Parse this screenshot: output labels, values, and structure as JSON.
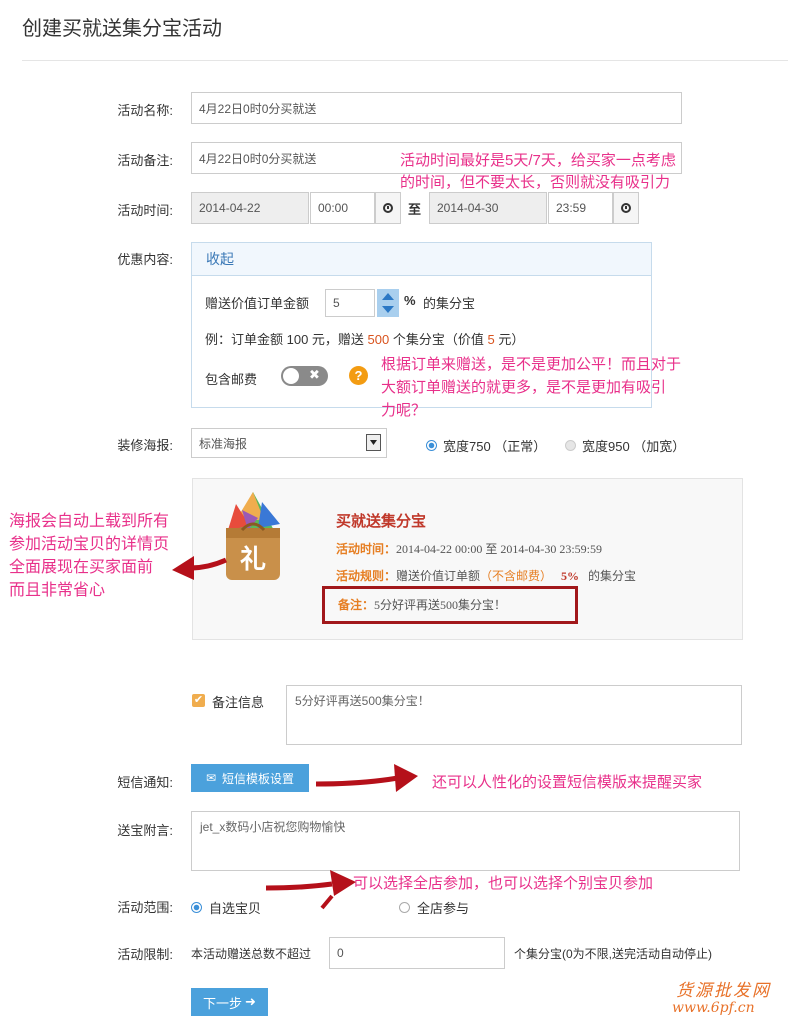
{
  "page": {
    "title": "创建买就送集分宝活动"
  },
  "form": {
    "name_label": "活动名称:",
    "name_value": "4月22日0时0分买就送",
    "remark_label": "活动备注:",
    "remark_value": "4月22日0时0分买就送",
    "time_label": "活动时间:",
    "start_date": "2014-04-22",
    "start_time": "00:00",
    "to_text": "至",
    "end_date": "2014-04-30",
    "end_time": "23:59",
    "discount_label": "优惠内容:",
    "poster_label": "装修海报:",
    "sms_label": "短信通知:",
    "gift_msg_label": "送宝附言:",
    "scope_label": "活动范围:",
    "limit_label": "活动限制:"
  },
  "discount": {
    "collapse": "收起",
    "give_prefix": "赠送价值订单金额",
    "percent_value": "5",
    "percent_suffix": "%",
    "jfb": "的集分宝",
    "example_a": "例：订单金额 100 元，赠送",
    "example_num": "500",
    "example_b": "个集分宝（价值",
    "example_val": "5",
    "example_c": "元）",
    "postage_label": "包含邮费",
    "help": "?"
  },
  "poster": {
    "select_value": "标准海报",
    "opt1": "宽度750 （正常）",
    "opt2": "宽度950 （加宽）",
    "gift_char": "礼",
    "heading": "买就送集分宝",
    "time_key": "活动时间：",
    "time_val": "2014-04-22 00:00 至 2014-04-30 23:59:59",
    "rule_key": "活动规则：",
    "rule_a": "赠送价值订单额",
    "rule_b": "（不含邮费）",
    "rule_pct": "5%",
    "rule_c": "的集分宝",
    "note_key": "备注：",
    "note_val": "5分好评再送500集分宝！"
  },
  "remark_info": {
    "label": "备注信息",
    "value": "5分好评再送500集分宝！"
  },
  "sms": {
    "button": "短信模板设置"
  },
  "gift_msg": {
    "value": "jet_x数码小店祝您购物愉快"
  },
  "scope": {
    "opt1": "自选宝贝",
    "opt2": "全店参与"
  },
  "limit": {
    "prefix": "本活动赠送总数不超过",
    "value": "0",
    "suffix": "个集分宝(0为不限,送完活动自动停止)"
  },
  "next": {
    "label": "下一步"
  },
  "annotations": {
    "a1_l1": "活动时间最好是5天/7天，给买家一点考虑",
    "a1_l2": "的时间，但不要太长，否则就没有吸引力",
    "a2_l1": "根据订单来赠送，是不是更加公平！而且对于",
    "a2_l2": "大额订单赠送的就更多，是不是更加有吸引",
    "a2_l3": "力呢？",
    "a3_l1": "海报会自动上载到所有",
    "a3_l2": "参加活动宝贝的详情页",
    "a3_l3": "全面展现在买家面前",
    "a3_l4": "而且非常省心",
    "a4": "还可以人性化的设置短信模版来提醒买家",
    "a5": "可以选择全店参加，也可以选择个别宝贝参加"
  },
  "watermark": {
    "cn": "货源批发网",
    "url": "www.6pf.cn"
  },
  "colors": {
    "annotation": "#e8308a",
    "arrow": "#b5101a",
    "button": "#4ba1dc",
    "poster_heading": "#c0392b",
    "poster_key": "#e67e22"
  }
}
